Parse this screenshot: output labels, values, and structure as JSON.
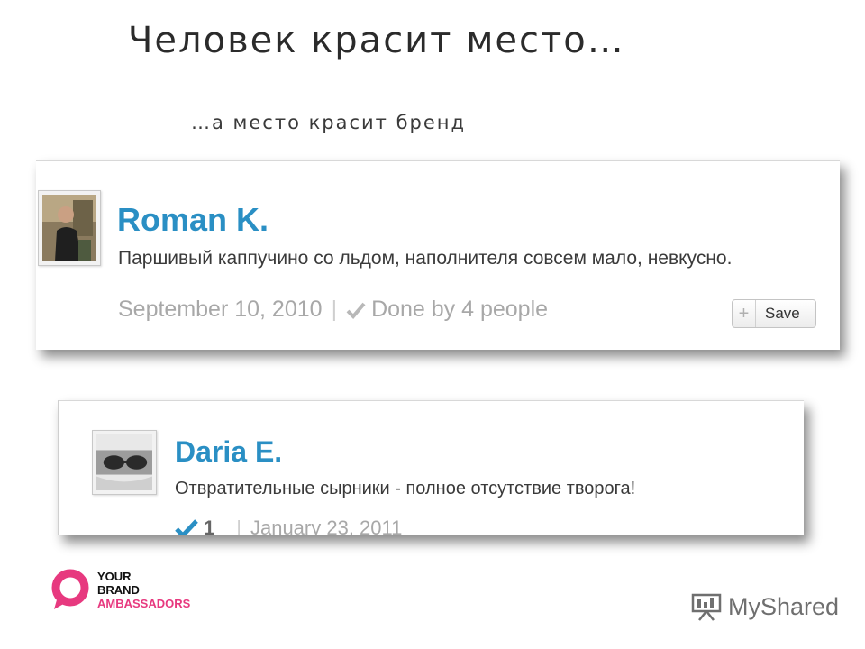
{
  "slide": {
    "title": "Человек красит место…",
    "subtitle": "…а место красит бренд"
  },
  "reviews": [
    {
      "author": "Roman K.",
      "text": "Паршивый каппучино со льдом, наполнителя совсем мало, невкусно.",
      "date": "September 10, 2010",
      "done_text": "Done by 4 people",
      "save_label": "Save"
    },
    {
      "author": "Daria E.",
      "text": "Отвратительные сырники - полное отсутствие творога!",
      "done_count": "1",
      "date": "January 23, 2011"
    }
  ],
  "brand": {
    "line1": "YOUR",
    "line2": "BRAND",
    "line3": "AMBASSADORS",
    "color": "#e7397f"
  },
  "watermark": {
    "text": "MyShared"
  },
  "colors": {
    "author_link": "#2a8fc4",
    "check": "#2a8fc4",
    "meta_gray": "#a8a8a8"
  },
  "icons": [
    "check-icon",
    "plus-icon",
    "brand-logo-mark",
    "presentation-icon"
  ]
}
